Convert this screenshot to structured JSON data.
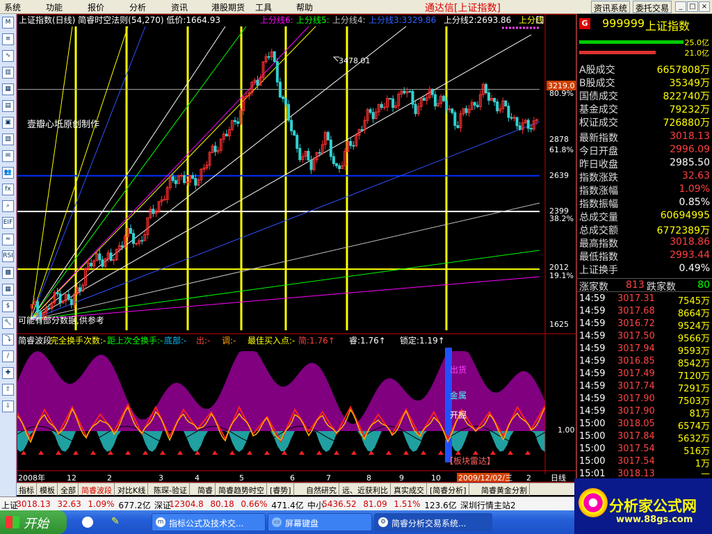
{
  "menu": [
    "系统",
    "功能",
    "报价",
    "分析",
    "资讯",
    "港股期货",
    "工具",
    "帮助"
  ],
  "app_title": "通达信[上证指数]",
  "top_buttons": [
    "资讯系统",
    "委托交易"
  ],
  "window_controls": [
    "_",
    "□",
    "×"
  ],
  "left_tools": [
    "M",
    "≡",
    "∿",
    "▥",
    "▦",
    "▤",
    "▣",
    "▧",
    "✉",
    "👥",
    "fx",
    "⌕",
    "EIF",
    "≈",
    "RSI",
    "▩",
    "▦",
    "$",
    "🔧",
    "⤵",
    "/",
    "✚",
    "⇧",
    "⇩"
  ],
  "chart_header": {
    "left": "上证指数(日线) 简睿时空法则(54,270) 低价:1664.93",
    "lines": [
      {
        "label": "上分线6:",
        "color": "#ff00ff"
      },
      {
        "label": "上分线5:",
        "color": "#00ff00"
      },
      {
        "label": "上分线4:",
        "color": "#c0c0c0"
      },
      {
        "label": "上分线3:3329.86",
        "color": "#3060ff"
      },
      {
        "label": "上分线2:2693.86",
        "color": "#ffffff"
      },
      {
        "label": "上分线",
        "color": "#ffff00"
      }
    ]
  },
  "annotations": {
    "peak": "3478.01",
    "watermark": "壹瓣心坻原创制作",
    "note": "可能有部分数据,供参考"
  },
  "price_axis": {
    "labels": [
      "80.9%",
      "2878",
      "61.8%",
      "2639",
      "2399",
      "38.2%",
      "2012",
      "19.1%",
      "1625"
    ],
    "current": "3219.0"
  },
  "indicator_header": [
    {
      "text": "简睿波段",
      "color": "#ffffff"
    },
    {
      "text": "完全换手次数:-",
      "color": "#ffff00"
    },
    {
      "text": "距上次全换手:-",
      "color": "#00ff00"
    },
    {
      "text": "底部:-",
      "color": "#00c0ff"
    },
    {
      "text": "出:-",
      "color": "#ff4040"
    },
    {
      "text": "调:-",
      "color": "#ffa000"
    },
    {
      "text": "最佳买入点:-",
      "color": "#ffff00"
    },
    {
      "text": "简:1.76↑",
      "color": "#ff4040"
    },
    {
      "text": "睿:1.76↑",
      "color": "#ffffff"
    },
    {
      "text": "锁定:1.19↑",
      "color": "#ffffff"
    }
  ],
  "indicator_labels": {
    "top": "出货",
    "mid": "金属",
    "low": "开掘",
    "bottom": "【板块雷达】",
    "level": "1.00"
  },
  "x_axis": {
    "labels": [
      "2008年",
      "12",
      "2",
      "3",
      "4",
      "5",
      "6",
      "7",
      "8",
      "9",
      "10",
      "11"
    ],
    "highlight": "2009/12/02/三",
    "tail": "2",
    "period": "日线"
  },
  "stock": {
    "code": "999999",
    "name": "上证指数",
    "up_pct": "25.0亿",
    "down_pct": "21.0亿"
  },
  "volumes": [
    {
      "label": "A股成交",
      "value": "6657808万"
    },
    {
      "label": "B股成交",
      "value": "35349万"
    },
    {
      "label": "国债成交",
      "value": "822740万"
    },
    {
      "label": "基金成交",
      "value": "79232万"
    },
    {
      "label": "权证成交",
      "value": "726880万"
    }
  ],
  "stats": [
    {
      "label": "最新指数",
      "value": "3018.13",
      "color": "#ff4040"
    },
    {
      "label": "今日开盘",
      "value": "2996.09",
      "color": "#ff4040"
    },
    {
      "label": "昨日收盘",
      "value": "2985.50",
      "color": "#ffffff"
    },
    {
      "label": "指数涨跌",
      "value": "32.63",
      "color": "#ff4040"
    },
    {
      "label": "指数涨幅",
      "value": "1.09%",
      "color": "#ff4040"
    },
    {
      "label": "指数振幅",
      "value": "0.85%",
      "color": "#ffffff"
    },
    {
      "label": "总成交量",
      "value": "60694995",
      "color": "#ffff00"
    },
    {
      "label": "总成交额",
      "value": "6772389万",
      "color": "#ffff00"
    },
    {
      "label": "最高指数",
      "value": "3018.86",
      "color": "#ff4040"
    },
    {
      "label": "最低指数",
      "value": "2993.44",
      "color": "#ff4040"
    },
    {
      "label": "上证换手",
      "value": "0.49%",
      "color": "#ffffff"
    }
  ],
  "updown": {
    "up_label": "涨家数",
    "up": "813",
    "down_label": "跌家数",
    "down": "80"
  },
  "ticks": [
    [
      "14:59",
      "3017.31",
      "7545万"
    ],
    [
      "14:59",
      "3017.68",
      "8664万"
    ],
    [
      "14:59",
      "3016.72",
      "9524万"
    ],
    [
      "14:59",
      "3017.50",
      "9566万"
    ],
    [
      "14:59",
      "3017.94",
      "9593万"
    ],
    [
      "14:59",
      "3016.85",
      "8542万"
    ],
    [
      "14:59",
      "3017.49",
      "7120万"
    ],
    [
      "14:59",
      "3017.74",
      "7291万"
    ],
    [
      "14:59",
      "3017.90",
      "7503万"
    ],
    [
      "14:59",
      "3017.90",
      "81万"
    ],
    [
      "15:00",
      "3018.05",
      "6574万"
    ],
    [
      "15:00",
      "3017.84",
      "5632万"
    ],
    [
      "15:00",
      "3017.54",
      "516万"
    ],
    [
      "15:00",
      "3017.54",
      "1万"
    ],
    [
      "15:01",
      "3018.13",
      "—"
    ]
  ],
  "rp_tabs": [
    "笔",
    "价",
    "细",
    "盘",
    "势",
    "指",
    "值",
    "筹"
  ],
  "bottom_tabs": [
    "指标",
    "模板",
    "全部",
    "简睿波段",
    "对比K线",
    "陈琛-验证",
    "简睿",
    "简睿趋势时空",
    "[睿势]",
    "自然研究",
    "远、近获利比",
    "真实成交",
    "[简睿分析]",
    "简睿黄金分割"
  ],
  "ticker": [
    {
      "text": "上证",
      "color": "#000000"
    },
    {
      "text": "3018.13",
      "color": "#d00000"
    },
    {
      "text": "32.63",
      "color": "#d00000"
    },
    {
      "text": "1.09%",
      "color": "#d00000"
    },
    {
      "text": "677.2亿",
      "color": "#000000"
    },
    {
      "text": "深证",
      "color": "#000000"
    },
    {
      "text": "12304.8",
      "color": "#d00000"
    },
    {
      "text": "80.18",
      "color": "#d00000"
    },
    {
      "text": "0.66%",
      "color": "#d00000"
    },
    {
      "text": "471.4亿",
      "color": "#000000"
    },
    {
      "text": "中小",
      "color": "#000000"
    },
    {
      "text": "5436.52",
      "color": "#d00000"
    },
    {
      "text": "81.09",
      "color": "#d00000"
    },
    {
      "text": "1.51%",
      "color": "#d00000"
    },
    {
      "text": "123.6亿",
      "color": "#000000"
    },
    {
      "text": "深圳行情主站2",
      "color": "#000000"
    }
  ],
  "taskbar": {
    "start": "开始",
    "buttons": [
      "指标公式及技术交...",
      "屏幕键盘",
      "简睿分析交易系统..."
    ]
  },
  "logo": {
    "title": "分析家公式网",
    "url": "www.88gs.com"
  },
  "chart_data": {
    "type": "line",
    "title": "上证指数(日线)",
    "series": [
      {
        "name": "上证指数",
        "values": [
          1750,
          1720,
          1850,
          1780,
          1990,
          2100,
          2060,
          2250,
          2180,
          2380,
          2520,
          2650,
          2580,
          2700,
          2860,
          2950,
          3150,
          3300,
          3478,
          3100,
          2820,
          2700,
          2900,
          2680,
          2850,
          3000,
          3100,
          3120,
          3210,
          3100,
          3190,
          3120,
          3000,
          3100,
          3200,
          3120,
          3050,
          2950,
          3018
        ]
      },
      {
        "name": "简",
        "values": [
          1.5,
          0.4,
          1.6,
          0.6,
          1.7,
          0.5,
          1.4,
          0.7,
          1.8,
          0.6,
          1.7,
          0.5,
          1.6,
          0.8,
          1.5,
          0.4,
          1.7,
          0.6,
          1.3,
          0.3,
          1.6,
          0.7,
          1.5,
          0.6,
          1.7,
          0.5,
          1.4,
          0.6,
          1.6,
          0.5,
          1.5,
          0.4,
          1.6,
          0.7,
          1.5,
          0.5,
          1.7,
          0.8,
          1.76
        ]
      }
    ],
    "ylim": [
      1625,
      3478.01
    ],
    "horizontal_levels": [
      3219,
      2639,
      2399,
      2012
    ],
    "fib_labels": [
      "80.9%",
      "61.8%",
      "38.2%",
      "19.1%"
    ]
  }
}
